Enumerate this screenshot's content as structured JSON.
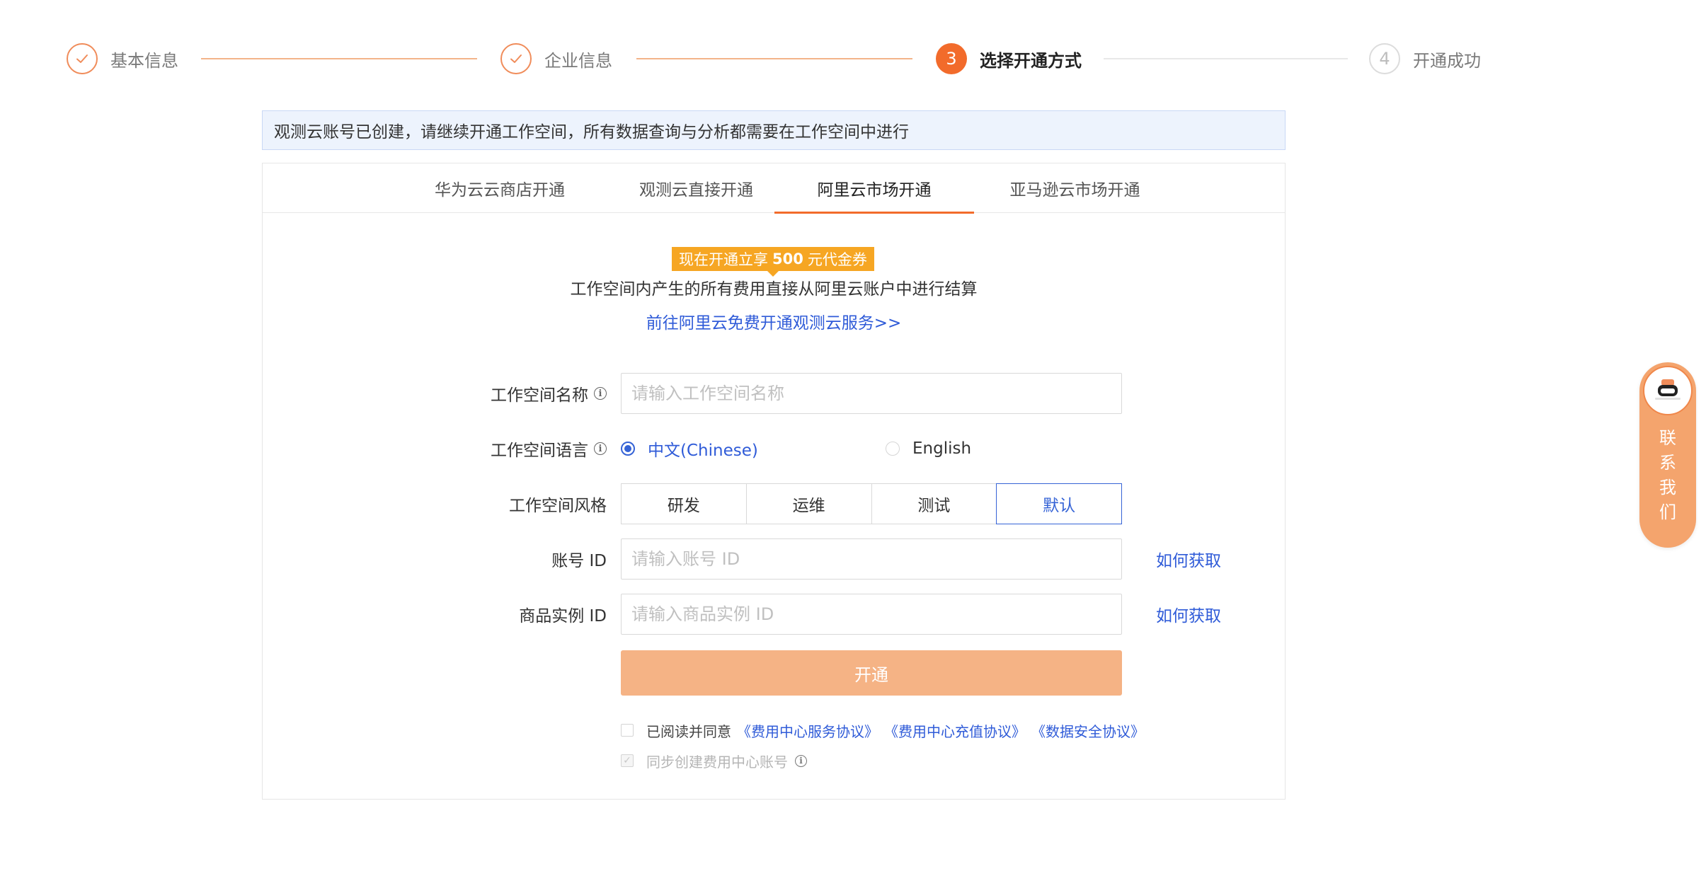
{
  "steps": [
    {
      "label": "基本信息",
      "state": "done",
      "icon": "check-icon"
    },
    {
      "label": "企业信息",
      "state": "done",
      "icon": "check-icon"
    },
    {
      "label": "选择开通方式",
      "state": "active",
      "number": "3"
    },
    {
      "label": "开通成功",
      "state": "todo",
      "number": "4"
    }
  ],
  "notice": "观测云账号已创建，请继续开通工作空间，所有数据查询与分析都需要在工作空间中进行",
  "tabs": [
    {
      "label": "华为云云商店开通"
    },
    {
      "label": "观测云直接开通"
    },
    {
      "label": "阿里云市场开通"
    },
    {
      "label": "亚马逊云市场开通"
    }
  ],
  "active_tab": "阿里云市场开通",
  "promo": {
    "badge_prefix": "现在开通立享",
    "badge_amount": "500",
    "badge_suffix": "元代金券",
    "description": "工作空间内产生的所有费用直接从阿里云账户中进行结算",
    "link": "前往阿里云免费开通观测云服务>>"
  },
  "form": {
    "workspace_name": {
      "label": "工作空间名称",
      "placeholder": "请输入工作空间名称",
      "value": ""
    },
    "workspace_language": {
      "label": "工作空间语言",
      "options": [
        {
          "label": "中文(Chinese)",
          "selected": true
        },
        {
          "label": "English",
          "selected": false
        }
      ]
    },
    "workspace_style": {
      "label": "工作空间风格",
      "options": [
        "研发",
        "运维",
        "测试",
        "默认"
      ],
      "selected": "默认"
    },
    "account_id": {
      "label": "账号 ID",
      "placeholder": "请输入账号 ID",
      "value": "",
      "help": "如何获取"
    },
    "instance_id": {
      "label": "商品实例 ID",
      "placeholder": "请输入商品实例 ID",
      "value": "",
      "help": "如何获取"
    },
    "submit": "开通",
    "agreement": {
      "text": "已阅读并同意",
      "links": [
        "《费用中心服务协议》",
        "《费用中心充值协议》",
        "《数据安全协议》"
      ],
      "checked": false
    },
    "sync": {
      "text": "同步创建费用中心账号",
      "checked": true,
      "disabled": true
    }
  },
  "contact": {
    "chars": [
      "联",
      "系",
      "我",
      "们"
    ]
  },
  "colors": {
    "accent": "#f26b2b",
    "link": "#2f5bd8",
    "primary_disabled": "#f5b385",
    "promo": "#f6a623"
  }
}
